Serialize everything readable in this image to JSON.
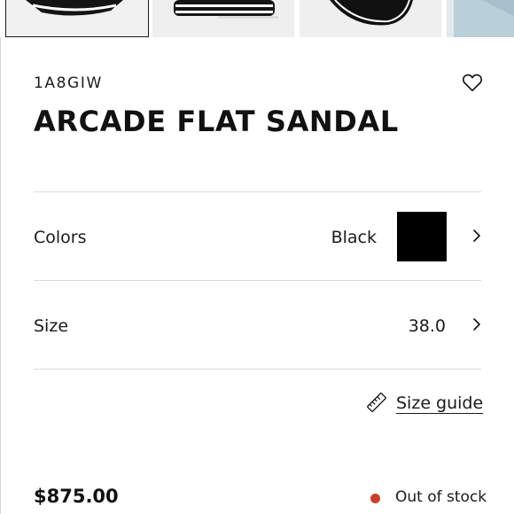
{
  "product": {
    "sku": "1A8GIW",
    "title": "ARCADE FLAT SANDAL",
    "price": "$875.00"
  },
  "options": {
    "colors": {
      "label": "Colors",
      "value": "Black",
      "swatch_color": "#000000"
    },
    "size": {
      "label": "Size",
      "value": "38.0"
    }
  },
  "size_guide": {
    "label": "Size guide"
  },
  "stock": {
    "label": "Out of stock",
    "dot_color": "#c8412c"
  },
  "icons": {
    "wishlist": "heart-icon",
    "chevron": "chevron-right-icon",
    "size_guide": "ruler-icon"
  },
  "thumbnails": [
    {
      "selected": true
    },
    {
      "selected": false
    },
    {
      "selected": false
    },
    {
      "selected": false
    }
  ]
}
